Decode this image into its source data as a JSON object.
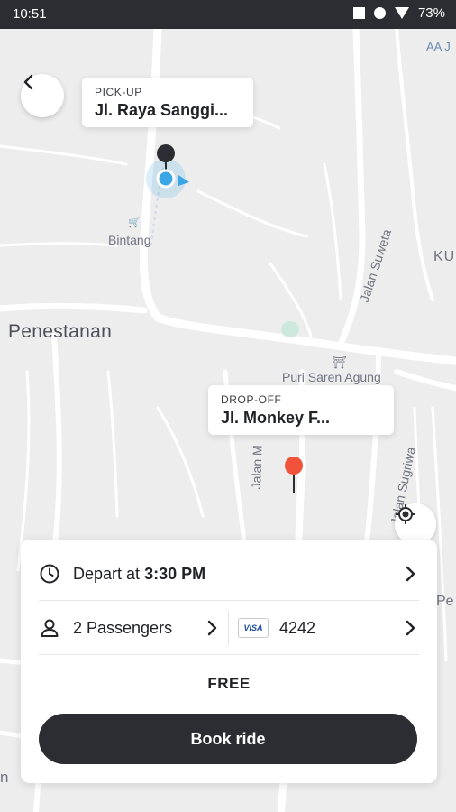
{
  "status_bar": {
    "time": "10:51",
    "battery": "73%"
  },
  "map": {
    "labels": {
      "penestanan": "Penestanan",
      "bintang": "Bintang",
      "jalan_suweta": "Jalan Suweta",
      "puri_saren_agung": "Puri Saren Agung",
      "jalan_sugriwa": "Jalan Sugriwa",
      "jalan_m": "Jalan M",
      "ku": "KU",
      "aa": "AA J",
      "pe": "Pe",
      "n": "n"
    }
  },
  "pickup": {
    "caption": "PICK-UP",
    "address": "Jl. Raya Sanggi..."
  },
  "dropoff": {
    "caption": "DROP-OFF",
    "address": "Jl. Monkey F..."
  },
  "booking": {
    "depart_prefix": "Depart at",
    "depart_time": "3:30 PM",
    "passengers": "2 Passengers",
    "card_brand": "VISA",
    "card_last4": "4242",
    "price": "FREE",
    "book_label": "Book ride"
  },
  "colors": {
    "dark": "#2c2d32",
    "pickup_blue": "#3aa6e6",
    "dropoff_red": "#f0533a"
  },
  "icons": [
    "back-arrow-icon",
    "my-location-icon",
    "clock-icon",
    "person-icon",
    "chevron-right-icon",
    "visa-card-icon"
  ]
}
